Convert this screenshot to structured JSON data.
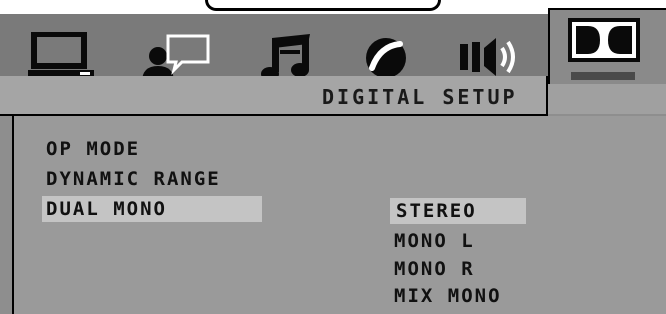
{
  "setup_menu": {
    "title": "DIGITAL SETUP",
    "tabs": [
      {
        "icon": "monitor-icon",
        "label": ""
      },
      {
        "icon": "language-speech-icon",
        "label": ""
      },
      {
        "icon": "music-note-icon",
        "label": ""
      },
      {
        "icon": "video-disc-icon",
        "label": ""
      },
      {
        "icon": "speaker-audio-icon",
        "label": ""
      },
      {
        "icon": "dolby-digital-icon",
        "label": "",
        "active": true
      }
    ],
    "items": [
      {
        "label": "OP MODE"
      },
      {
        "label": "DYNAMIC RANGE"
      },
      {
        "label": "DUAL MONO",
        "selected": true
      }
    ],
    "dual_mono_options": [
      {
        "label": "STEREO",
        "selected": true
      },
      {
        "label": "MONO L"
      },
      {
        "label": "MONO R"
      },
      {
        "label": "MIX MONO"
      }
    ]
  },
  "colors": {
    "panel": "#9a9a9a",
    "header": "#7a7a7a",
    "highlight": "#c4c4c4",
    "text": "#111111"
  }
}
